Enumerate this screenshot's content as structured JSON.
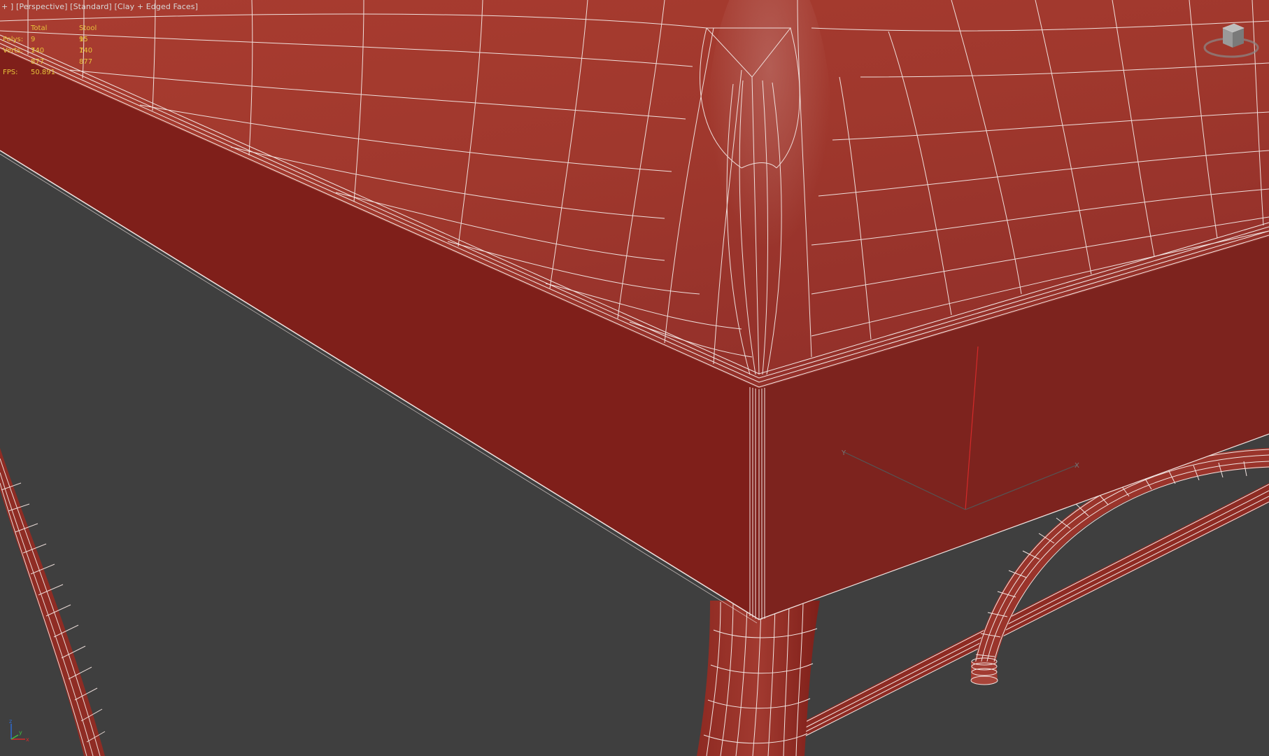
{
  "viewport": {
    "label_parts": [
      "+",
      "Perspective",
      "Standard",
      "Clay + Edged Faces"
    ]
  },
  "stats": {
    "header_total": "Total",
    "header_object": "Stool 15",
    "polys_label": "Polys:",
    "polys_total": "9 140",
    "polys_object": "9 140",
    "verts_label": "Verts:",
    "verts_total": "7 877",
    "verts_object": "7 877",
    "fps_label": "FPS:",
    "fps_value": "50.891"
  },
  "viewcube": {
    "icon": "viewcube-icon"
  },
  "axis_tripod": {
    "icon": "axis-tripod-icon",
    "x_label": "x",
    "y_label": "y",
    "z_label": "z"
  },
  "colors": {
    "background": "#3f3f3f",
    "clay_dark": "#7f1f1a",
    "clay_mid": "#a33a2e",
    "clay_light": "#b54a3d",
    "wire": "#f4e8e5",
    "stats_text": "#e6c23a",
    "label_text": "#d8d8d8",
    "gizmo_x": "#d42a2a",
    "gizmo_y": "#3fbf3f",
    "gizmo_z": "#2e6bd4"
  }
}
